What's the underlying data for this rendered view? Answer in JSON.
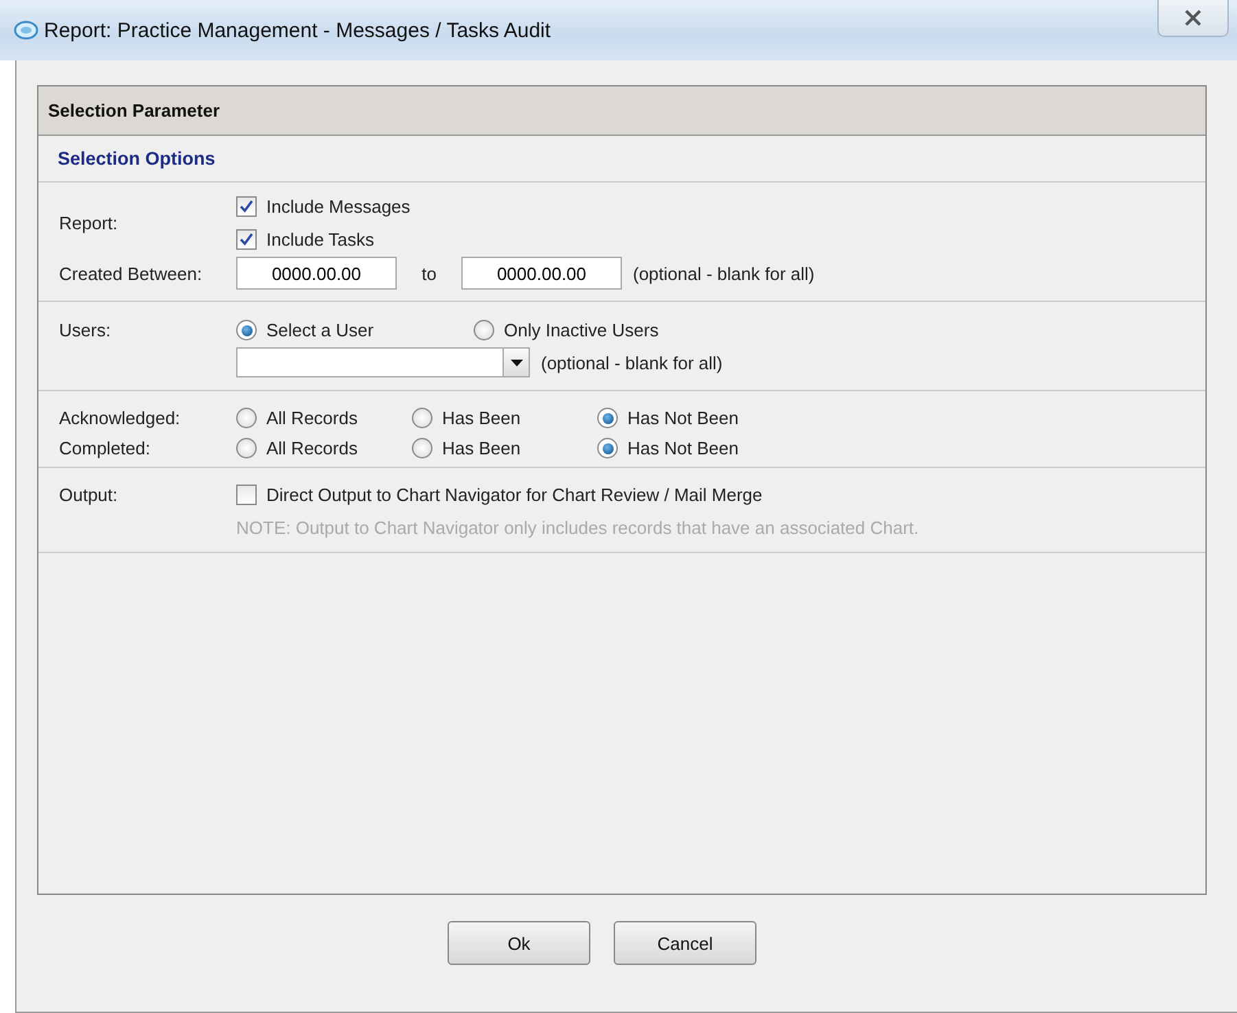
{
  "window": {
    "title": "Report: Practice Management - Messages / Tasks Audit"
  },
  "panel": {
    "header": "Selection Parameter",
    "section_title": "Selection Options"
  },
  "report": {
    "label": "Report:",
    "options": [
      {
        "label": "Include Messages",
        "checked": true
      },
      {
        "label": "Include Tasks",
        "checked": true
      }
    ]
  },
  "created_between": {
    "label": "Created Between:",
    "from": "0000.00.00",
    "to_label": "to",
    "to": "0000.00.00",
    "hint": "(optional - blank for all)"
  },
  "users": {
    "label": "Users:",
    "options": [
      {
        "label": "Select a User",
        "selected": true
      },
      {
        "label": "Only Inactive Users",
        "selected": false
      }
    ],
    "hint": "(optional - blank for all)"
  },
  "filters": [
    {
      "label": "Acknowledged:",
      "options": [
        {
          "label": "All Records",
          "selected": false
        },
        {
          "label": "Has Been",
          "selected": false
        },
        {
          "label": "Has Not Been",
          "selected": true
        }
      ]
    },
    {
      "label": "Completed:",
      "options": [
        {
          "label": "All Records",
          "selected": false
        },
        {
          "label": "Has Been",
          "selected": false
        },
        {
          "label": "Has Not Been",
          "selected": true
        }
      ]
    }
  ],
  "output": {
    "label": "Output:",
    "option": {
      "label": "Direct Output to Chart Navigator for Chart Review / Mail Merge",
      "checked": false
    },
    "note": "NOTE: Output to Chart Navigator only includes records that have an associated Chart."
  },
  "buttons": [
    "Ok",
    "Cancel"
  ]
}
